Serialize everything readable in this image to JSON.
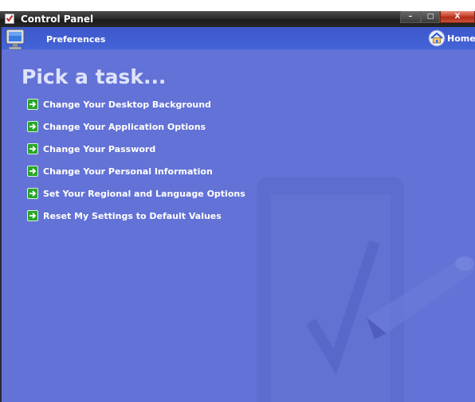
{
  "window": {
    "title": "Control Panel",
    "icon": "control-panel-icon",
    "buttons": {
      "minimize_icon": "minimize-icon",
      "maximize_icon": "maximize-icon",
      "close_icon": "close-icon",
      "minimize_glyph": "–",
      "maximize_glyph": "□",
      "close_glyph": "X"
    }
  },
  "toolbar": {
    "section_label": "Preferences",
    "section_icon": "monitor-icon",
    "home_label": "Home",
    "home_icon": "home-icon"
  },
  "main": {
    "heading": "Pick a task...",
    "tasks": [
      {
        "label": "Change Your Desktop Background",
        "icon": "green-arrow-icon"
      },
      {
        "label": "Change Your Application Options",
        "icon": "green-arrow-icon"
      },
      {
        "label": "Change Your Password",
        "icon": "green-arrow-icon"
      },
      {
        "label": "Change Your Personal Information",
        "icon": "green-arrow-icon"
      },
      {
        "label": "Set Your Regional and Language Options",
        "icon": "green-arrow-icon"
      },
      {
        "label": "Reset My Settings to Default Values",
        "icon": "green-arrow-icon"
      }
    ],
    "watermark_icon": "checklist-pen-watermark"
  },
  "colors": {
    "background": "#6372d6",
    "toolbar": "#4464d6",
    "heading": "#dfe3fb",
    "arrow_green": "#2aa52a",
    "close_red": "#c8412c"
  }
}
